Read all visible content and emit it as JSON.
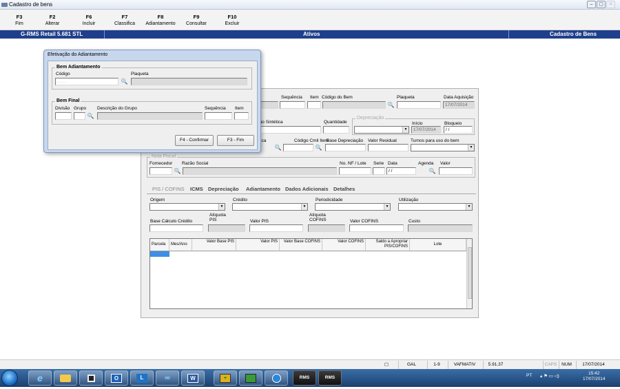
{
  "window": {
    "title": "Cadastro de bens",
    "controls": [
      "–",
      "▢",
      "✕"
    ]
  },
  "fkeys": [
    {
      "key": "F3",
      "label": "Fim"
    },
    {
      "key": "F2",
      "label": "Alterar"
    },
    {
      "key": "F6",
      "label": "Incluir"
    },
    {
      "key": "F7",
      "label": "Classifica"
    },
    {
      "key": "F8",
      "label": "Adiantamento"
    },
    {
      "key": "F9",
      "label": "Consultar"
    },
    {
      "key": "F10",
      "label": "Excluir"
    }
  ],
  "header": {
    "left": "G-RMS Retail 5.681 STL",
    "center": "Ativos",
    "right": "Cadastro de Bens",
    "color": "#1f3f8c"
  },
  "dialog": {
    "title": "Efetivação do Adiantamento",
    "bem_adiantamento": {
      "caption": "Bem Adiantamento",
      "codigo_label": "Código",
      "codigo_value": ". . . .",
      "plaqueta_label": "Plaqueta"
    },
    "bem_final": {
      "caption": "Bem Final",
      "divisao_label": "Divisão",
      "grupo_label": "Grupo",
      "descricao_label": "Descrição do Grupo",
      "sequencia_label": "Sequência",
      "item_label": "Item"
    },
    "confirm_button": "F4 - Confirmar",
    "fim_button": "F3 - Fim"
  },
  "form": {
    "sequencia": "Sequência",
    "item": "Item",
    "codigo_bem": "Código do Bem",
    "plaqueta": "Plaqueta",
    "data_aquisicao": "Data Aquisição",
    "data_aquisicao_value": "17/07/2014",
    "descricao_sintetica": "ição Sintética",
    "quantidade": "Quantidade",
    "depreciacao_caption": "Depreciação",
    "inicio": "Início",
    "inicio_value": "17/07/2014",
    "bloqueio": "Bloqueio",
    "bloqueio_value": "/ /",
    "conta_partial": "ica",
    "codigo_cmil_item": "Código Cmil Item",
    "base_depreciacao": "Base Depreciação",
    "valor_residual": "Valor Residual",
    "turnos": "Turnos para uso do bem",
    "nota_fiscal_caption": "Nota Fiscal",
    "fornecedor": "Fornecedor",
    "razao_social": "Razão Social",
    "nf_lote": "No. NF / Lote",
    "serie": "Serie",
    "data": "Data",
    "data_value": "/ /",
    "agenda": "Agenda",
    "valor": "Valor"
  },
  "tabs": [
    "PIS / COFINS",
    "ICMS",
    "Depreciação",
    "Adiantamento",
    "Dados Adicionais",
    "Detalhes"
  ],
  "piscofins": {
    "origem": "Origem",
    "credito": "Crédito",
    "periodicidade": "Periodicidade",
    "utilizacao": "Utilização",
    "base_calculo": "Base Cálculo Crédito",
    "aliquota_pis": "Alíquota\nPIS",
    "valor_pis": "Valor PIS",
    "aliquota_cofins": "Alíquota\nCOFINS",
    "valor_cofins": "Valor COFINS",
    "custo": "Custo"
  },
  "grid_headers": [
    "Parcela",
    "Mes/Ano",
    "Valor Base PIS",
    "Valor PIS",
    "Valor Base COFINS",
    "Valor COFINS",
    "Saldo a Apropriar PIS/COFINS",
    "Lote"
  ],
  "status": {
    "gal": "GAL",
    "page": "1-9",
    "module": "VAFMATIV",
    "version": "5.91.37",
    "caps": "CAPS",
    "num": "NUM",
    "date": "17/07/2014"
  },
  "taskbar": {
    "apps": [
      "start-orb",
      "internet-explorer",
      "file-explorer",
      "media",
      "outlook",
      "lync",
      "meeting",
      "word",
      "app-plus",
      "app-green",
      "app-globe",
      "RMS",
      "RMS"
    ],
    "lang": "PT",
    "time": "15:42",
    "date": "17/07/2014"
  }
}
